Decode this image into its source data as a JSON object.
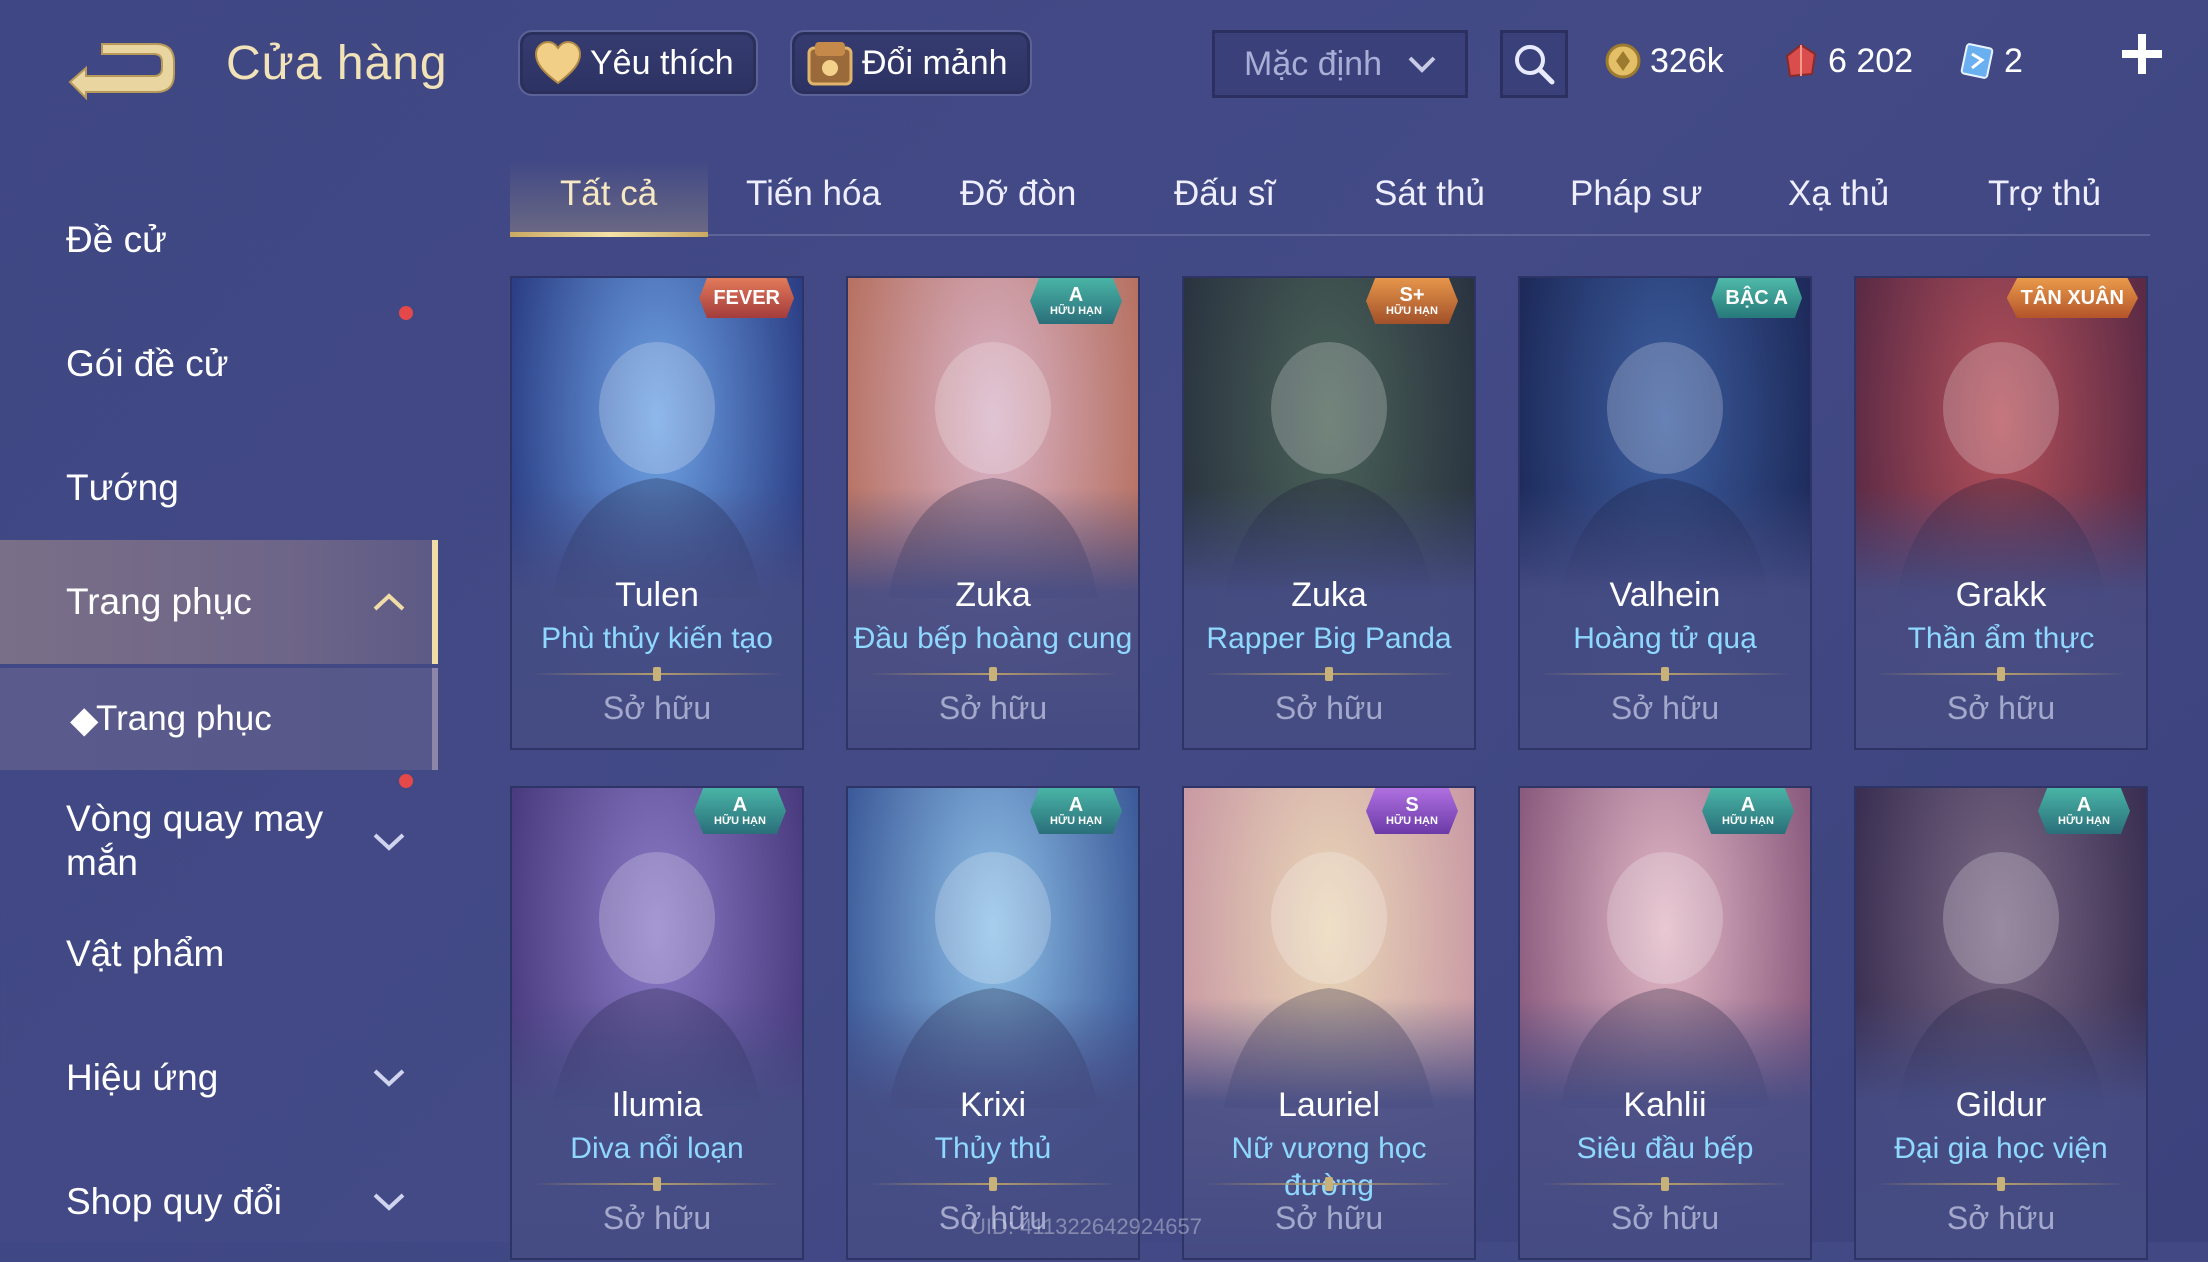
{
  "header": {
    "title": "Cửa hàng",
    "favorites_label": "Yêu thích",
    "exchange_label": "Đổi mảnh",
    "sort_value": "Mặc định",
    "currencies": [
      {
        "icon": "gold-coin-icon",
        "value": "326k"
      },
      {
        "icon": "red-gem-icon",
        "value": "6 202"
      },
      {
        "icon": "voucher-icon",
        "value": "2"
      }
    ]
  },
  "sidebar": {
    "items": [
      {
        "label": "Đề cử"
      },
      {
        "label": "Gói đề cử"
      },
      {
        "label": "Tướng"
      },
      {
        "label": "Trang phục"
      },
      {
        "label": "Trang phục"
      },
      {
        "label": "Vòng quay may mắn"
      },
      {
        "label": "Vật phẩm"
      },
      {
        "label": "Hiệu ứng"
      },
      {
        "label": "Shop quy đổi"
      }
    ]
  },
  "tabs": [
    "Tất cả",
    "Tiến hóa",
    "Đỡ đòn",
    "Đấu sĩ",
    "Sát thủ",
    "Pháp sư",
    "Xạ thủ",
    "Trợ thủ"
  ],
  "cards": [
    {
      "hero": "Tulen",
      "skin": "Phù thủy kiến tạo",
      "status": "Sở hữu",
      "badge": "FEVER",
      "colors": [
        "#6fa4e6",
        "#2c3f86"
      ]
    },
    {
      "hero": "Zuka",
      "skin": "Đầu bếp hoàng cung",
      "status": "Sở hữu",
      "badge_grade": "A",
      "badge_sub": "HỮU HẠN",
      "colors": [
        "#d9b4c9",
        "#b77263"
      ]
    },
    {
      "hero": "Zuka",
      "skin": "Rapper Big Panda",
      "status": "Sở hữu",
      "badge_grade": "S+",
      "badge_sub": "HỮU HẠN",
      "colors": [
        "#4b6258",
        "#2a3440"
      ]
    },
    {
      "hero": "Valhein",
      "skin": "Hoàng tử quạ",
      "status": "Sở hữu",
      "badge": "BẬC A",
      "colors": [
        "#3d5fa1",
        "#1d2a5a"
      ]
    },
    {
      "hero": "Grakk",
      "skin": "Thần ẩm thực",
      "status": "Sở hữu",
      "badge": "TÂN XUÂN",
      "colors": [
        "#b5515a",
        "#5b2a45"
      ]
    },
    {
      "hero": "Ilumia",
      "skin": "Diva nổi loạn",
      "status": "Sở hữu",
      "badge_grade": "A",
      "badge_sub": "HỮU HẠN",
      "colors": [
        "#8c7cc8",
        "#4a3a7e"
      ]
    },
    {
      "hero": "Krixi",
      "skin": "Thủy thủ",
      "status": "Sở hữu",
      "badge_grade": "A",
      "badge_sub": "HỮU HẠN",
      "colors": [
        "#8fc1e8",
        "#3d5b9a"
      ]
    },
    {
      "hero": "Lauriel",
      "skin": "Nữ vương học đường",
      "status": "Sở hữu",
      "badge_grade": "S",
      "badge_sub": "HỮU HẠN",
      "colors": [
        "#ead7b8",
        "#c99aa4"
      ]
    },
    {
      "hero": "Kahlii",
      "skin": "Siêu đầu bếp",
      "status": "Sở hữu",
      "badge_grade": "A",
      "badge_sub": "HỮU HẠN",
      "colors": [
        "#e2b9c6",
        "#8b5b7e"
      ]
    },
    {
      "hero": "Gildur",
      "skin": "Đại gia học viện",
      "status": "Sở hữu",
      "badge_grade": "A",
      "badge_sub": "HỮU HẠN",
      "colors": [
        "#7c6a86",
        "#3a2f52"
      ]
    }
  ],
  "footer": {
    "uid": "UID: 411322642924657"
  }
}
